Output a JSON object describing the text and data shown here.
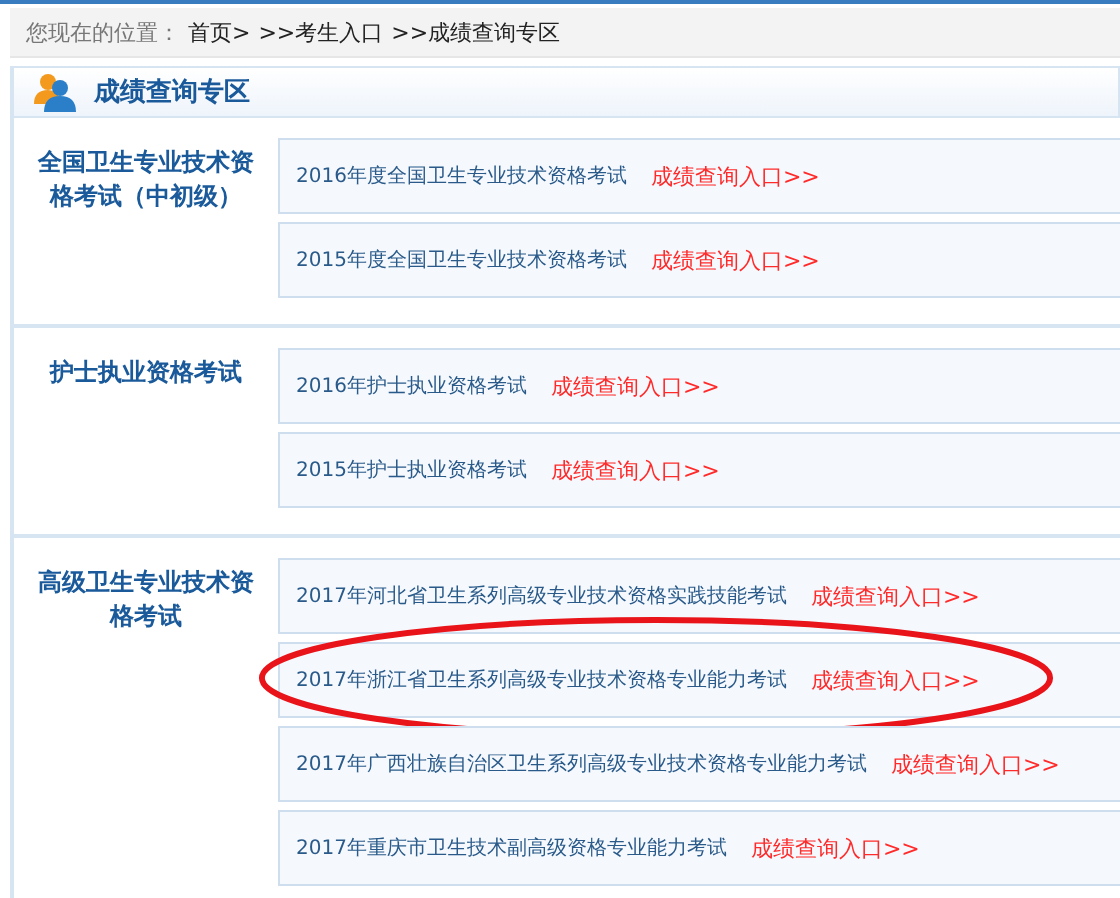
{
  "breadcrumb": {
    "label": "您现在的位置：",
    "items": [
      "首页>",
      ">>考生入口",
      ">>成绩查询专区"
    ]
  },
  "panel": {
    "title": "成绩查询专区"
  },
  "sections": [
    {
      "title": "全国卫生专业技术资格考试（中初级）",
      "entries": [
        {
          "name": "2016年度全国卫生专业技术资格考试",
          "link": "成绩查询入口>>",
          "circled": false
        },
        {
          "name": "2015年度全国卫生专业技术资格考试",
          "link": "成绩查询入口>>",
          "circled": false
        }
      ]
    },
    {
      "title": "护士执业资格考试",
      "entries": [
        {
          "name": "2016年护士执业资格考试",
          "link": "成绩查询入口>>",
          "circled": false
        },
        {
          "name": "2015年护士执业资格考试",
          "link": "成绩查询入口>>",
          "circled": false
        }
      ]
    },
    {
      "title": "高级卫生专业技术资格考试",
      "entries": [
        {
          "name": "2017年河北省卫生系列高级专业技术资格实践技能考试",
          "link": "成绩查询入口>>",
          "circled": false
        },
        {
          "name": "2017年浙江省卫生系列高级专业技术资格专业能力考试",
          "link": "成绩查询入口>>",
          "circled": true
        },
        {
          "name": "2017年广西壮族自治区卫生系列高级专业技术资格专业能力考试",
          "link": "成绩查询入口>>",
          "circled": false
        },
        {
          "name": "2017年重庆市卫生技术副高级资格专业能力考试",
          "link": "成绩查询入口>>",
          "circled": false
        }
      ]
    }
  ]
}
